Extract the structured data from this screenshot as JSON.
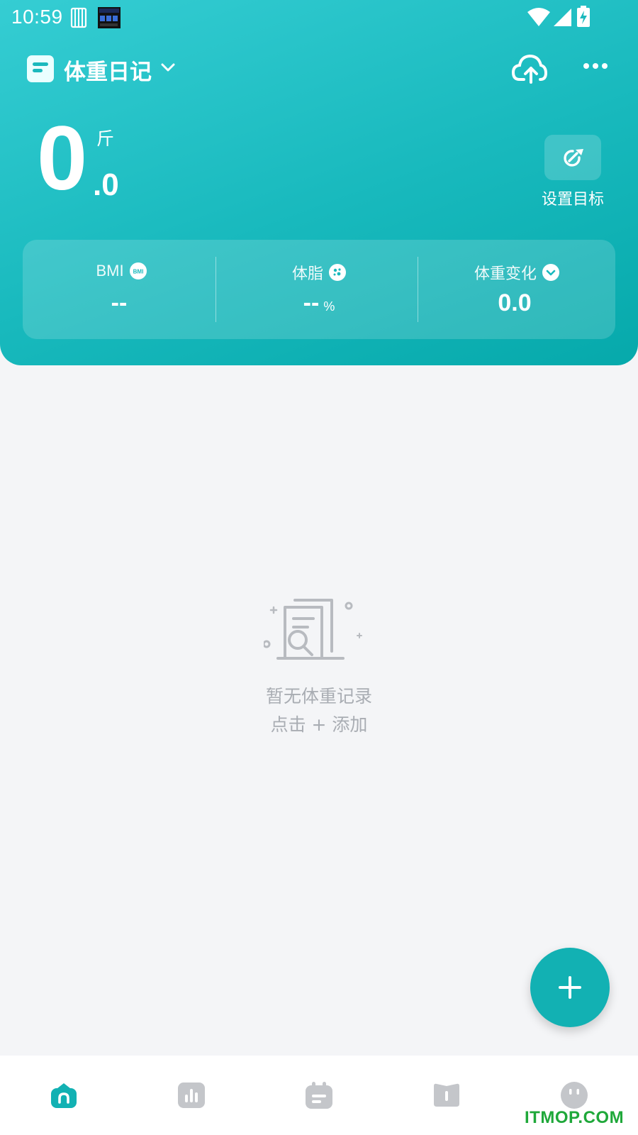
{
  "status_bar": {
    "time": "10:59"
  },
  "header": {
    "app_title": "体重日记",
    "weight_integer": "0",
    "weight_unit": "斤",
    "weight_decimal": ".0",
    "goal_label": "设置目标"
  },
  "stats": [
    {
      "label": "BMI",
      "value": "--",
      "unit": ""
    },
    {
      "label": "体脂",
      "value": "--",
      "unit": "%"
    },
    {
      "label": "体重变化",
      "value": "0.0",
      "unit": ""
    }
  ],
  "empty_state": {
    "line1": "暂无体重记录",
    "line2": "点击 + 添加"
  },
  "tabs": [
    {
      "icon": "home-icon",
      "active": true
    },
    {
      "icon": "chart-icon",
      "active": false
    },
    {
      "icon": "calendar-icon",
      "active": false
    },
    {
      "icon": "book-icon",
      "active": false
    },
    {
      "icon": "profile-icon",
      "active": false
    }
  ],
  "watermark": "ITMOP.COM",
  "colors": {
    "accent": "#12b1b3",
    "header_start": "#35cdd3",
    "header_end": "#06a9ab",
    "background": "#f4f5f7",
    "muted_text": "#a9adb3",
    "inactive_icon": "#c4c6ca"
  }
}
